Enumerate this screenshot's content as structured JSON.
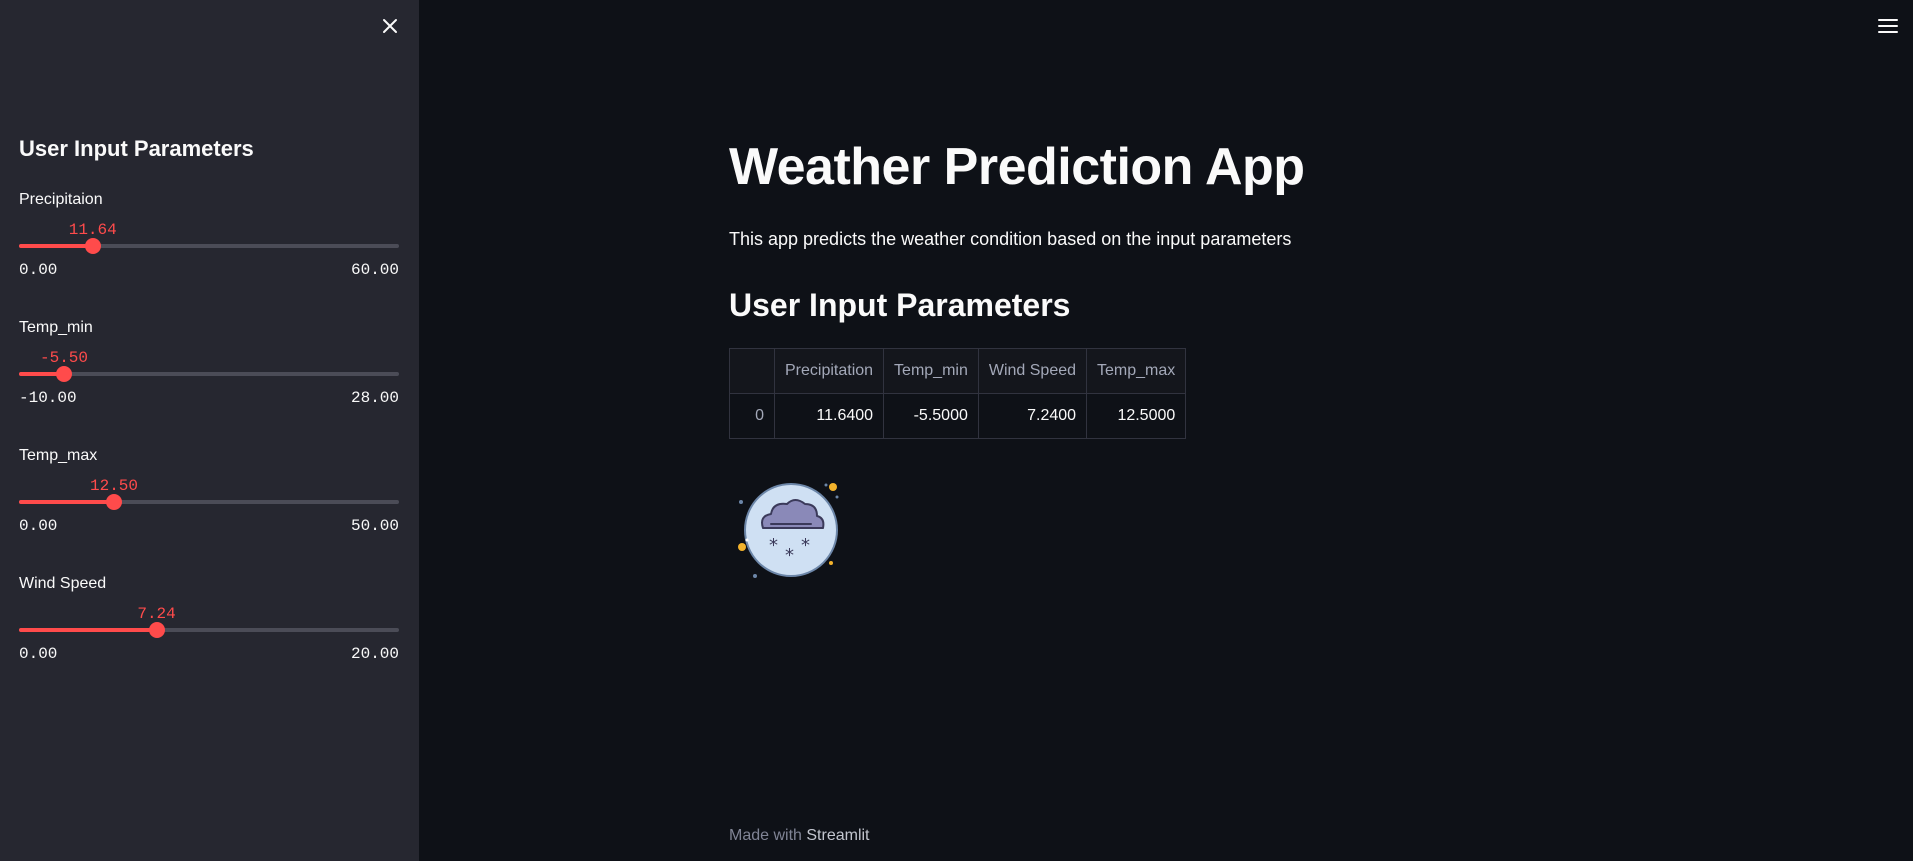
{
  "sidebar": {
    "title": "User Input Parameters",
    "sliders": [
      {
        "label": "Precipitaion",
        "value": 11.64,
        "value_text": "11.64",
        "min_text": "0.00",
        "max_text": "60.00",
        "min": 0,
        "max": 60
      },
      {
        "label": "Temp_min",
        "value": -5.5,
        "value_text": "-5.50",
        "min_text": "-10.00",
        "max_text": "28.00",
        "min": -10,
        "max": 28
      },
      {
        "label": "Temp_max",
        "value": 12.5,
        "value_text": "12.50",
        "min_text": "0.00",
        "max_text": "50.00",
        "min": 0,
        "max": 50
      },
      {
        "label": "Wind Speed",
        "value": 7.24,
        "value_text": "7.24",
        "min_text": "0.00",
        "max_text": "20.00",
        "min": 0,
        "max": 20
      }
    ]
  },
  "main": {
    "title": "Weather Prediction App",
    "description": "This app predicts the weather condition based on the input parameters",
    "subtitle": "User Input Parameters",
    "table": {
      "columns": [
        "",
        "Precipitation",
        "Temp_min",
        "Wind Speed",
        "Temp_max"
      ],
      "rows": [
        [
          "0",
          "11.6400",
          "-5.5000",
          "7.2400",
          "12.5000"
        ]
      ]
    },
    "prediction_icon": "snow-cloud-icon"
  },
  "footer": {
    "prefix": "Made with",
    "brand": "Streamlit"
  },
  "colors": {
    "accent": "#ff4b4b",
    "background": "#0e1117",
    "sidebar": "#262730"
  }
}
